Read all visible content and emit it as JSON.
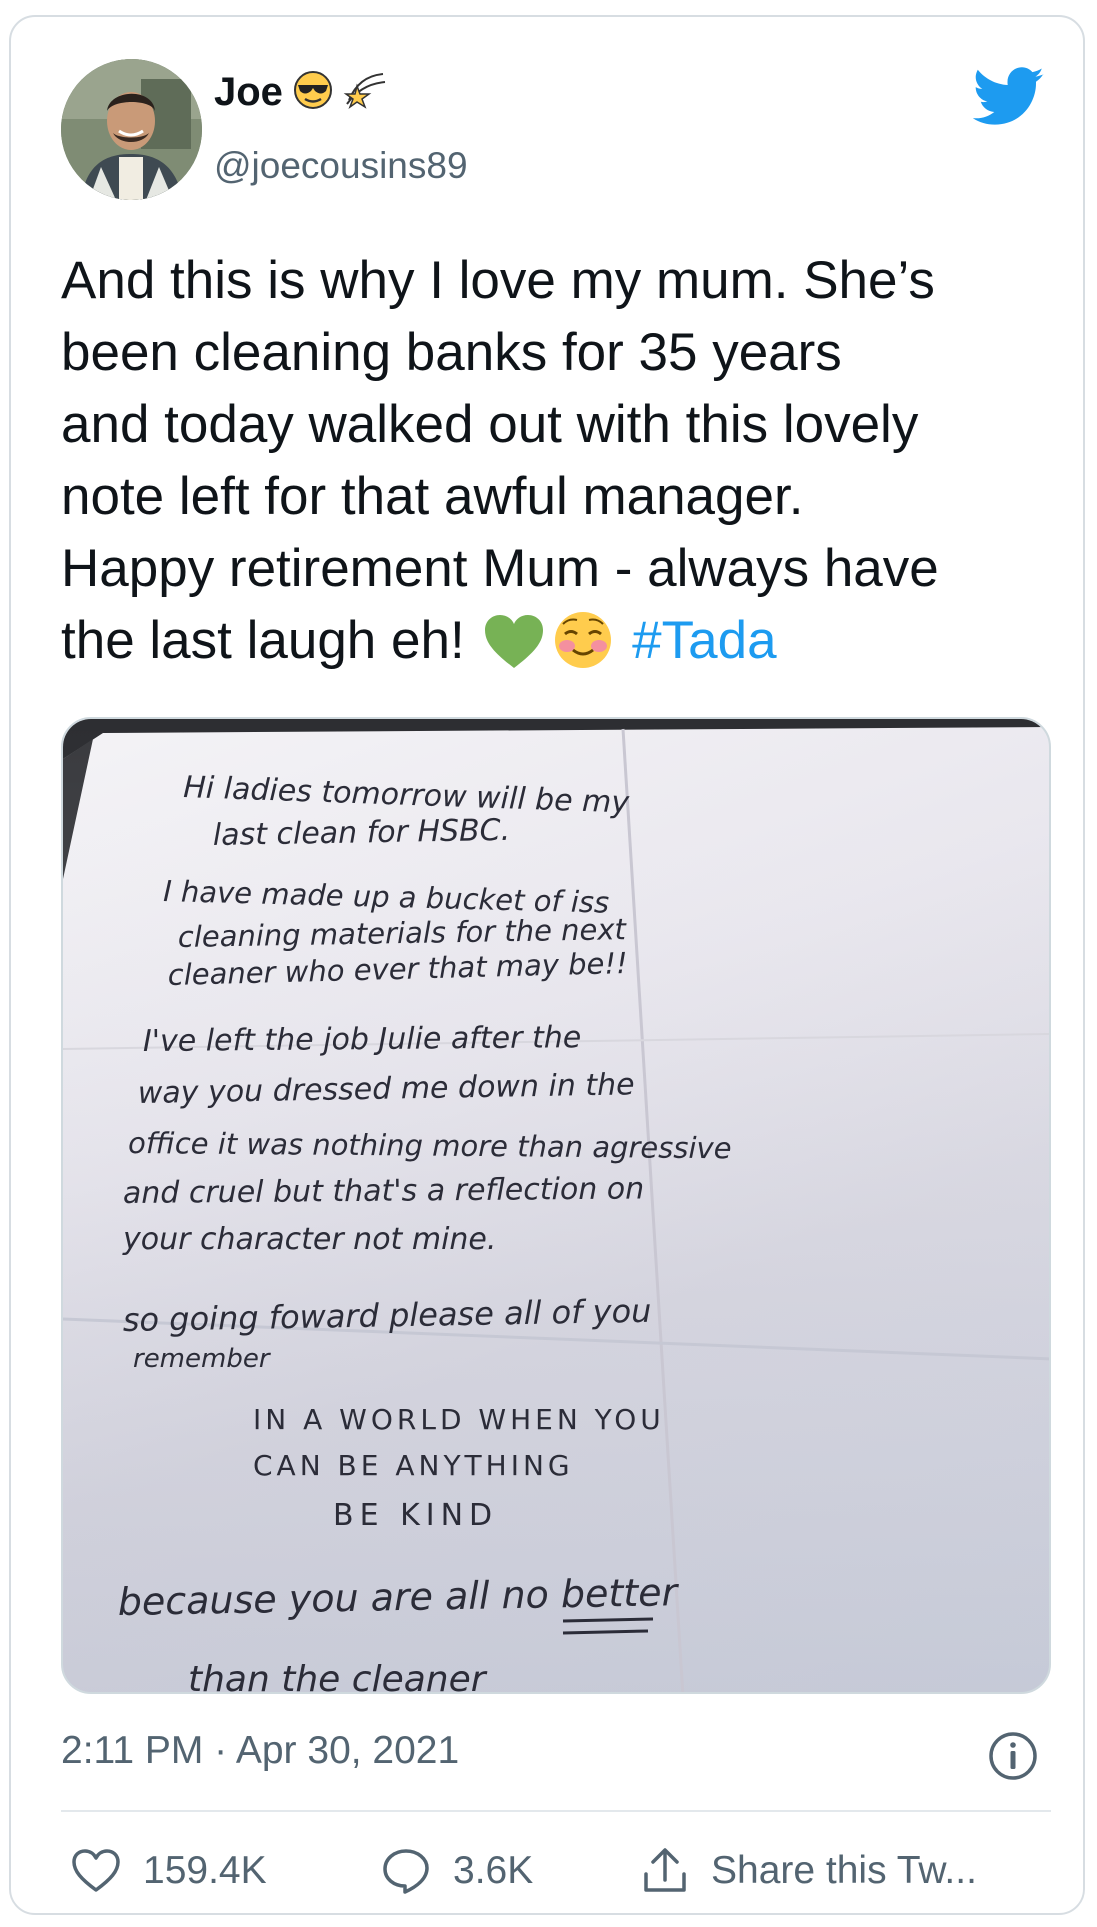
{
  "tweet": {
    "display_name": "Joe",
    "name_emojis": [
      "sunglasses-emoji",
      "shooting-star-emoji"
    ],
    "handle": "@joecousins89",
    "text_lines": [
      "And this is why I love my mum. She’s",
      "been cleaning banks for 35 years",
      "and today walked out with this lovely",
      "note left for that awful manager.",
      "Happy retirement Mum - always have",
      "the last laugh eh!"
    ],
    "hashtag": "#Tada",
    "text_emojis": [
      "green-heart-emoji",
      "smiling-blushing-emoji"
    ],
    "timestamp": "2:11 PM · Apr 30, 2021"
  },
  "note": {
    "lines": [
      "Hi ladies tomorrow will be my",
      "last clean for HSBC.",
      "I have made up a bucket of iss",
      "cleaning materials for the next",
      "cleaner who ever that may be!!",
      "I've left the job Julie after the",
      "way you dressed me down in the",
      "office it was nothing more than agressive",
      "and cruel but that's a reflection on",
      "your character not mine.",
      "so going foward please all of you",
      "remember",
      "IN A WORLD WHEN YOU",
      "CAN BE ANYTHING",
      "BE KIND",
      "because you are all no better",
      "than the cleaner"
    ]
  },
  "actions": {
    "likes": "159.4K",
    "replies": "3.6K",
    "share_label": "Share this Tw..."
  },
  "colors": {
    "link": "#1d9bf0",
    "secondary_text": "#536471",
    "twitter_blue": "#1d9bf0",
    "border": "#d7dde2"
  }
}
